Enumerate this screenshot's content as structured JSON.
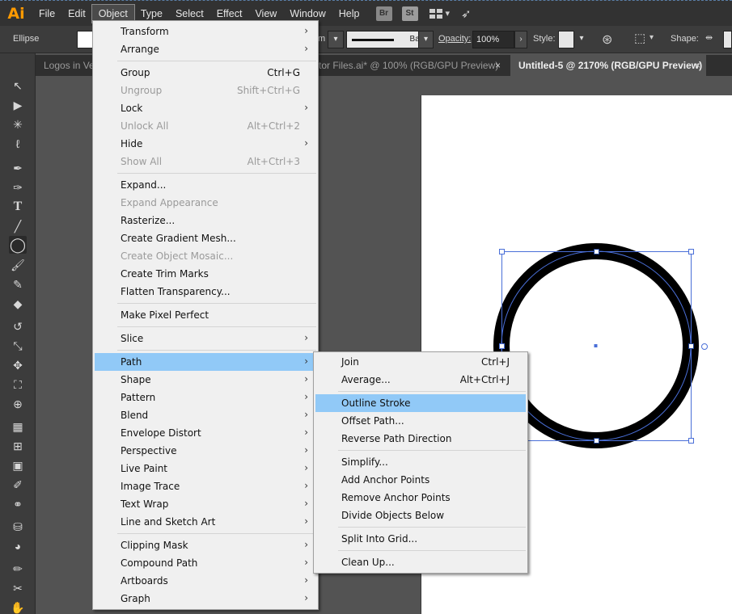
{
  "app": {
    "logo": "Ai"
  },
  "menubar": {
    "items": [
      "File",
      "Edit",
      "Object",
      "Type",
      "Select",
      "Effect",
      "View",
      "Window",
      "Help"
    ],
    "app_icons": [
      "Br",
      "St"
    ]
  },
  "controlbar": {
    "object_type": "Ellipse",
    "stroke_weight_unit": "m",
    "brush_name": "Basic",
    "opacity_label": "Opacity:",
    "opacity_value": "100%",
    "style_label": "Style:",
    "shape_label": "Shape:"
  },
  "tabs": [
    {
      "label": "Logos in Ve",
      "active": false
    },
    {
      "label": "tor Files.ai* @ 100% (RGB/GPU Preview)",
      "active": false
    },
    {
      "label": "Untitled-5 @ 2170% (RGB/GPU Preview)",
      "active": true
    }
  ],
  "tab_close_glyph": "×",
  "toolbar": {
    "tools": [
      "selection-tool",
      "direct-selection-tool",
      "magic-wand-tool",
      "lasso-tool",
      "pen-tool",
      "curvature-tool",
      "type-tool",
      "line-segment-tool",
      "ellipse-tool",
      "paintbrush-tool",
      "shaper-tool",
      "eraser-tool",
      "rotate-tool",
      "scale-tool",
      "puppet-warp-tool",
      "free-transform-tool",
      "shape-builder-tool",
      "perspective-grid-tool",
      "mesh-tool",
      "gradient-tool",
      "eyedropper-tool",
      "blend-tool",
      "symbol-sprayer-tool",
      "column-graph-tool",
      "artboard-tool",
      "slice-tool",
      "hand-tool"
    ],
    "active_tool": "ellipse-tool"
  },
  "object_menu": {
    "items": [
      {
        "label": "Transform",
        "shortcut": "",
        "submenu": true,
        "disabled": false
      },
      {
        "label": "Arrange",
        "shortcut": "",
        "submenu": true,
        "disabled": false
      },
      {
        "sep": true
      },
      {
        "label": "Group",
        "shortcut": "Ctrl+G",
        "submenu": false,
        "disabled": false
      },
      {
        "label": "Ungroup",
        "shortcut": "Shift+Ctrl+G",
        "submenu": false,
        "disabled": true
      },
      {
        "label": "Lock",
        "shortcut": "",
        "submenu": true,
        "disabled": false
      },
      {
        "label": "Unlock All",
        "shortcut": "Alt+Ctrl+2",
        "submenu": false,
        "disabled": true
      },
      {
        "label": "Hide",
        "shortcut": "",
        "submenu": true,
        "disabled": false
      },
      {
        "label": "Show All",
        "shortcut": "Alt+Ctrl+3",
        "submenu": false,
        "disabled": true
      },
      {
        "sep": true
      },
      {
        "label": "Expand...",
        "shortcut": "",
        "submenu": false,
        "disabled": false
      },
      {
        "label": "Expand Appearance",
        "shortcut": "",
        "submenu": false,
        "disabled": true
      },
      {
        "label": "Rasterize...",
        "shortcut": "",
        "submenu": false,
        "disabled": false
      },
      {
        "label": "Create Gradient Mesh...",
        "shortcut": "",
        "submenu": false,
        "disabled": false
      },
      {
        "label": "Create Object Mosaic...",
        "shortcut": "",
        "submenu": false,
        "disabled": true
      },
      {
        "label": "Create Trim Marks",
        "shortcut": "",
        "submenu": false,
        "disabled": false
      },
      {
        "label": "Flatten Transparency...",
        "shortcut": "",
        "submenu": false,
        "disabled": false
      },
      {
        "sep": true
      },
      {
        "label": "Make Pixel Perfect",
        "shortcut": "",
        "submenu": false,
        "disabled": false
      },
      {
        "sep": true
      },
      {
        "label": "Slice",
        "shortcut": "",
        "submenu": true,
        "disabled": false
      },
      {
        "sep": true
      },
      {
        "label": "Path",
        "shortcut": "",
        "submenu": true,
        "disabled": false,
        "highlighted": true
      },
      {
        "label": "Shape",
        "shortcut": "",
        "submenu": true,
        "disabled": false
      },
      {
        "label": "Pattern",
        "shortcut": "",
        "submenu": true,
        "disabled": false
      },
      {
        "label": "Blend",
        "shortcut": "",
        "submenu": true,
        "disabled": false
      },
      {
        "label": "Envelope Distort",
        "shortcut": "",
        "submenu": true,
        "disabled": false
      },
      {
        "label": "Perspective",
        "shortcut": "",
        "submenu": true,
        "disabled": false
      },
      {
        "label": "Live Paint",
        "shortcut": "",
        "submenu": true,
        "disabled": false
      },
      {
        "label": "Image Trace",
        "shortcut": "",
        "submenu": true,
        "disabled": false
      },
      {
        "label": "Text Wrap",
        "shortcut": "",
        "submenu": true,
        "disabled": false
      },
      {
        "label": "Line and Sketch Art",
        "shortcut": "",
        "submenu": true,
        "disabled": false
      },
      {
        "sep": true
      },
      {
        "label": "Clipping Mask",
        "shortcut": "",
        "submenu": true,
        "disabled": false
      },
      {
        "label": "Compound Path",
        "shortcut": "",
        "submenu": true,
        "disabled": false
      },
      {
        "label": "Artboards",
        "shortcut": "",
        "submenu": true,
        "disabled": false
      },
      {
        "label": "Graph",
        "shortcut": "",
        "submenu": true,
        "disabled": false
      }
    ]
  },
  "path_submenu": {
    "items": [
      {
        "label": "Join",
        "shortcut": "Ctrl+J"
      },
      {
        "label": "Average...",
        "shortcut": "Alt+Ctrl+J"
      },
      {
        "sep": true
      },
      {
        "label": "Outline Stroke",
        "shortcut": "",
        "highlighted": true
      },
      {
        "label": "Offset Path...",
        "shortcut": ""
      },
      {
        "label": "Reverse Path Direction",
        "shortcut": ""
      },
      {
        "sep": true
      },
      {
        "label": "Simplify...",
        "shortcut": ""
      },
      {
        "label": "Add Anchor Points",
        "shortcut": ""
      },
      {
        "label": "Remove Anchor Points",
        "shortcut": ""
      },
      {
        "label": "Divide Objects Below",
        "shortcut": ""
      },
      {
        "sep": true
      },
      {
        "label": "Split Into Grid...",
        "shortcut": ""
      },
      {
        "sep": true
      },
      {
        "label": "Clean Up...",
        "shortcut": ""
      }
    ]
  },
  "colors": {
    "menu_highlight": "#91c9f7",
    "selection": "#4a6fd8",
    "ai_orange": "#ff9a00"
  }
}
